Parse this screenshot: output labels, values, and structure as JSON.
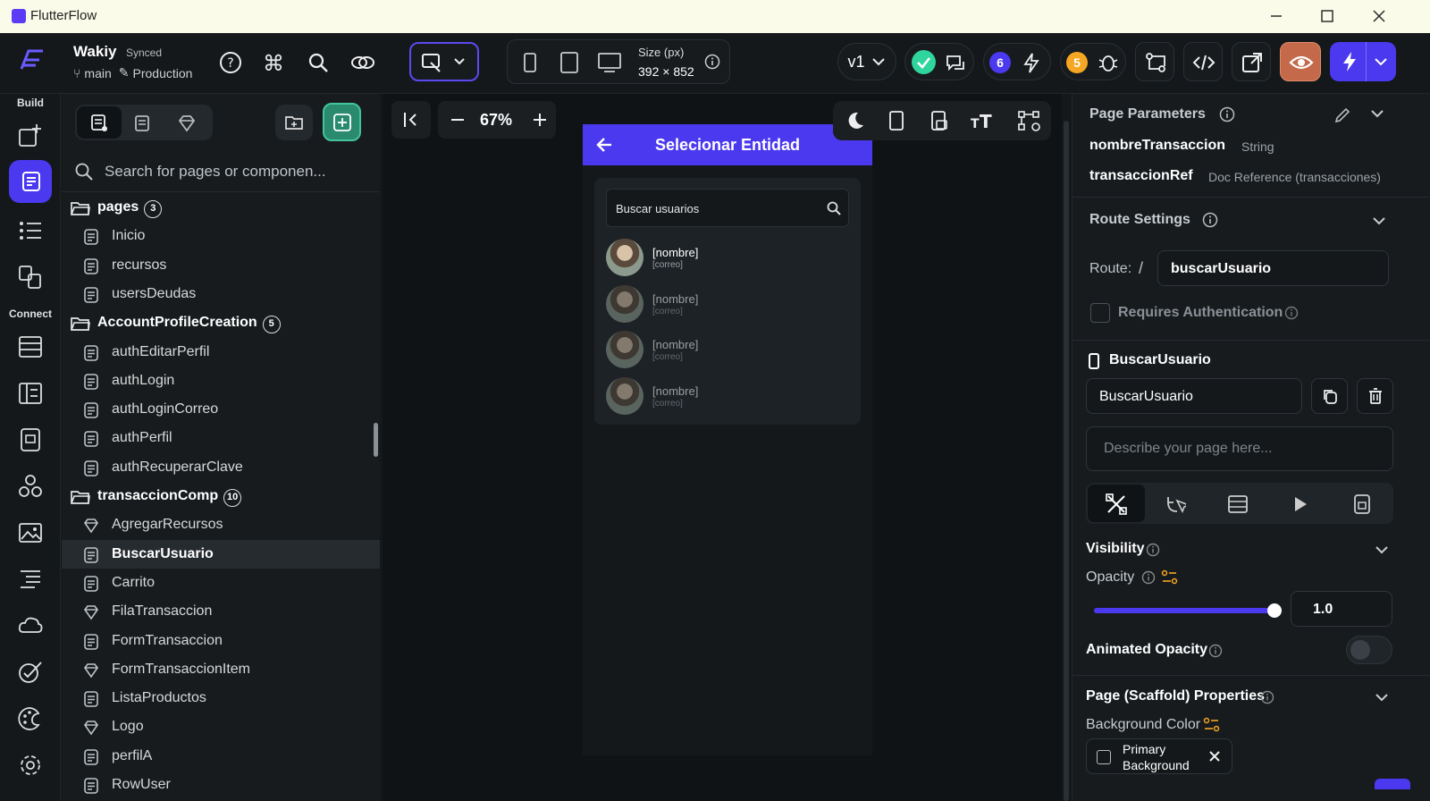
{
  "window": {
    "title": "FlutterFlow"
  },
  "project": {
    "name": "Wakiy",
    "sync_status": "Synced",
    "branch": "main",
    "environment": "Production"
  },
  "device": {
    "size_label": "Size (px)",
    "size_value": "392 × 852"
  },
  "version": {
    "label": "v1"
  },
  "counts": {
    "issues": "6",
    "warnings": "5"
  },
  "rail": {
    "build_label": "Build",
    "connect_label": "Connect"
  },
  "tree": {
    "search_placeholder": "Search for pages or componen...",
    "folders": [
      {
        "name": "pages",
        "count": "3",
        "items": [
          "Inicio",
          "recursos",
          "usersDeudas"
        ]
      },
      {
        "name": "AccountProfileCreation",
        "count": "5",
        "items": [
          "authEditarPerfil",
          "authLogin",
          "authLoginCorreo",
          "authPerfil",
          "authRecuperarClave"
        ]
      },
      {
        "name": "transaccionComp",
        "count": "10",
        "items": [
          "AgregarRecursos",
          "BuscarUsuario",
          "Carrito",
          "FilaTransaccion",
          "FormTransaccion",
          "FormTransaccionItem",
          "ListaProductos",
          "Logo",
          "perfilA",
          "RowUser"
        ]
      }
    ]
  },
  "canvas": {
    "zoom": "67%",
    "appbar_title": "Selecionar Entidad",
    "search_placeholder": "Buscar usuarios",
    "users": [
      {
        "name": "[nombre]",
        "mail": "[correo]"
      },
      {
        "name": "[nombre]",
        "mail": "[correo]"
      },
      {
        "name": "[nombre]",
        "mail": "[correo]"
      },
      {
        "name": "[nombre]",
        "mail": "[correo]"
      }
    ]
  },
  "props": {
    "page_params_title": "Page Parameters",
    "params": [
      {
        "name": "nombreTransaccion",
        "type": "String"
      },
      {
        "name": "transaccionRef",
        "type": "Doc Reference (transacciones)"
      }
    ],
    "route_title": "Route Settings",
    "route_label": "Route:",
    "route_slash": "/",
    "route_value": "buscarUsuario",
    "requires_auth": "Requires Authentication",
    "widget_name": "BuscarUsuario",
    "name_field": "BuscarUsuario",
    "describe_placeholder": "Describe your page here...",
    "visibility": "Visibility",
    "opacity_label": "Opacity",
    "opacity_value": "1.0",
    "opacity_fraction": 1.0,
    "animated_opacity": "Animated Opacity",
    "scaffold_title": "Page (Scaffold) Properties",
    "bg_color_label": "Background Color",
    "bg_color_line1": "Primary",
    "bg_color_line2": "Background"
  },
  "colors": {
    "accent": "#4b39ef",
    "success": "#2fd59c",
    "warning": "#f5a623",
    "danger_btn": "#c46a4a"
  }
}
